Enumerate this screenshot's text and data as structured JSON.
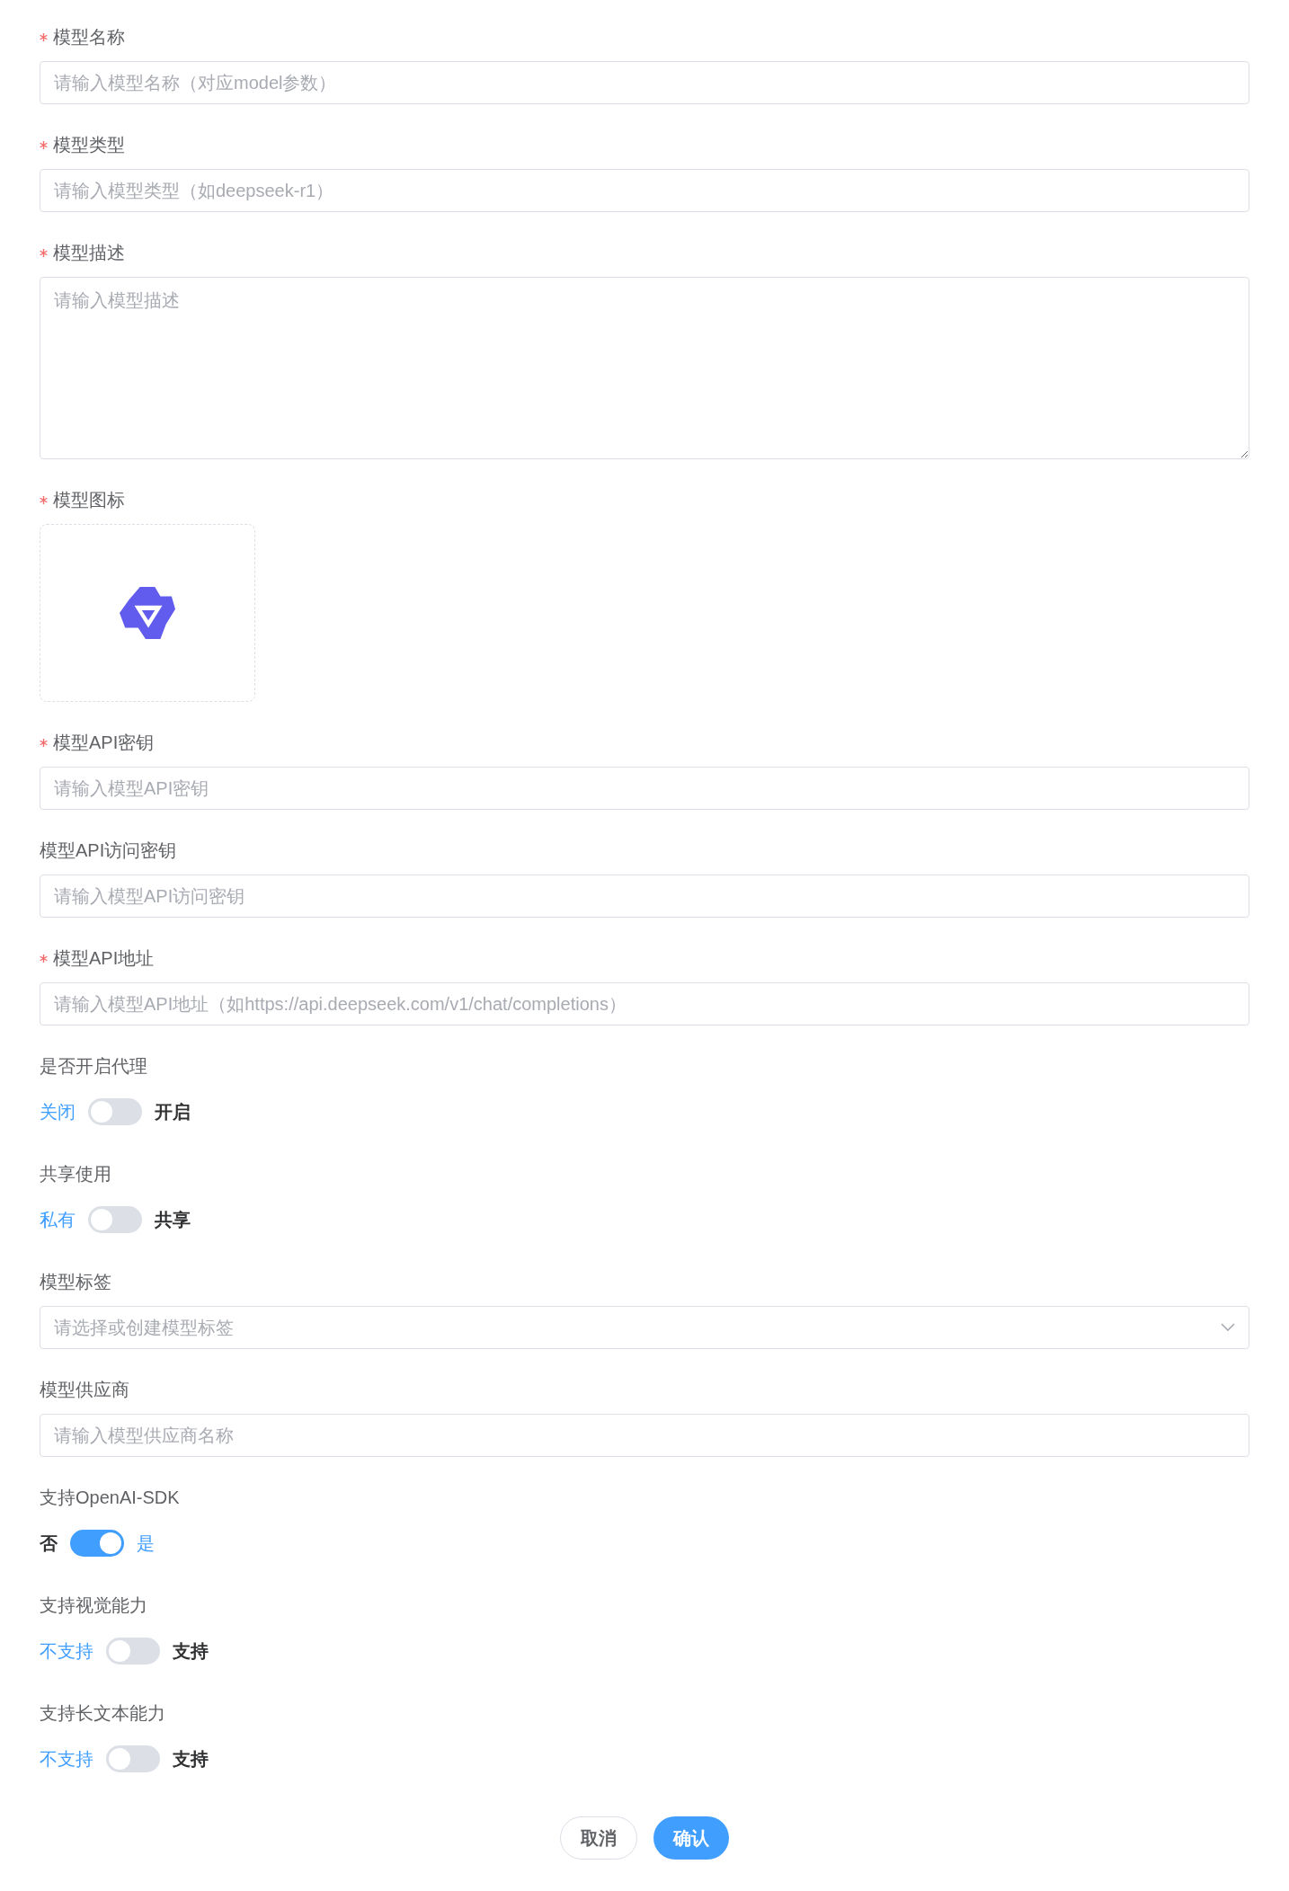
{
  "fields": [
    {
      "kind": "input",
      "label": "模型名称",
      "required": true,
      "placeholder": "请输入模型名称（对应model参数）"
    },
    {
      "kind": "input",
      "label": "模型类型",
      "required": true,
      "placeholder": "请输入模型类型（如deepseek-r1）"
    },
    {
      "kind": "textarea",
      "label": "模型描述",
      "required": true,
      "placeholder": "请输入模型描述"
    },
    {
      "kind": "upload",
      "label": "模型图标",
      "required": true
    },
    {
      "kind": "input",
      "label": "模型API密钥",
      "required": true,
      "placeholder": "请输入模型API密钥"
    },
    {
      "kind": "input",
      "label": "模型API访问密钥",
      "required": false,
      "placeholder": "请输入模型API访问密钥"
    },
    {
      "kind": "input",
      "label": "模型API地址",
      "required": true,
      "placeholder": "请输入模型API地址（如https://api.deepseek.com/v1/chat/completions）"
    },
    {
      "kind": "switch",
      "label": "是否开启代理",
      "required": false,
      "off_label": "关闭",
      "on_label": "开启",
      "on": false
    },
    {
      "kind": "switch",
      "label": "共享使用",
      "required": false,
      "off_label": "私有",
      "on_label": "共享",
      "on": false
    },
    {
      "kind": "select",
      "label": "模型标签",
      "required": false,
      "placeholder": "请选择或创建模型标签"
    },
    {
      "kind": "input",
      "label": "模型供应商",
      "required": false,
      "placeholder": "请输入模型供应商名称"
    },
    {
      "kind": "switch",
      "label": "支持OpenAI-SDK",
      "required": false,
      "off_label": "否",
      "on_label": "是",
      "on": true
    },
    {
      "kind": "switch",
      "label": "支持视觉能力",
      "required": false,
      "off_label": "不支持",
      "on_label": "支持",
      "on": false
    },
    {
      "kind": "switch",
      "label": "支持长文本能力",
      "required": false,
      "off_label": "不支持",
      "on_label": "支持",
      "on": false
    }
  ],
  "buttons": [
    {
      "label": "取消",
      "kind": "secondary"
    },
    {
      "label": "确认",
      "kind": "primary"
    }
  ]
}
